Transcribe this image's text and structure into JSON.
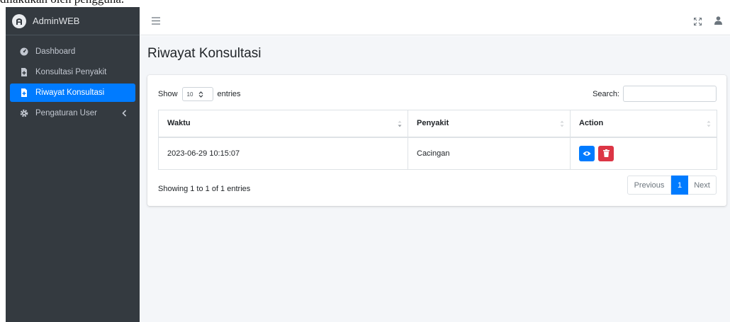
{
  "document_fragment": "dilakukan oleh pengguna.",
  "brand": {
    "name": "AdminWEB",
    "logo_icon": "brand-logo-icon"
  },
  "sidebar": {
    "items": [
      {
        "label": "Dashboard",
        "icon": "tachometer-icon",
        "active": false
      },
      {
        "label": "Konsultasi Penyakit",
        "icon": "file-medical-icon",
        "active": false
      },
      {
        "label": "Riwayat Konsultasi",
        "icon": "file-medical-icon",
        "active": true
      },
      {
        "label": "Pengaturan User",
        "icon": "cog-icon",
        "active": false,
        "has_submenu": true
      }
    ]
  },
  "topbar": {
    "menu_icon": "hamburger-icon",
    "fullscreen_icon": "expand-icon",
    "user_icon": "user-icon"
  },
  "page": {
    "title": "Riwayat Konsultasi"
  },
  "table_controls": {
    "show_label": "Show",
    "page_length": "10",
    "entries_label": "entries",
    "search_label": "Search:",
    "search_value": ""
  },
  "table": {
    "columns": [
      "Waktu",
      "Penyakit",
      "Action"
    ],
    "rows": [
      {
        "waktu": "2023-06-29 10:15:07",
        "penyakit": "Cacingan"
      }
    ]
  },
  "footer": {
    "info": "Showing 1 to 1 of 1 entries",
    "prev_label": "Previous",
    "current_page": "1",
    "next_label": "Next"
  },
  "colors": {
    "sidebar_bg": "#343a40",
    "active": "#007bff",
    "danger": "#dc3545",
    "content_bg": "#f4f6f9"
  }
}
